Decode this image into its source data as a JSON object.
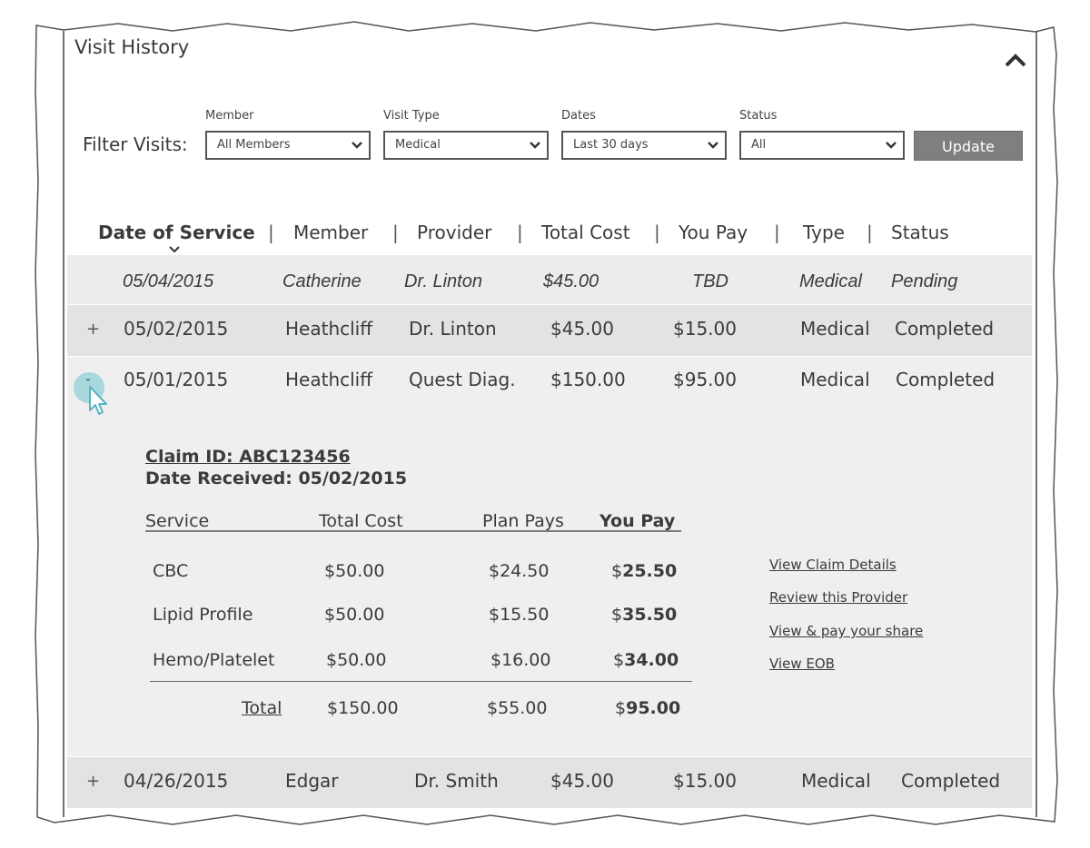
{
  "panel": {
    "title": "Visit History"
  },
  "filters": {
    "label": "Filter Visits:",
    "member": {
      "label": "Member",
      "value": "All Members"
    },
    "visit_type": {
      "label": "Visit Type",
      "value": "Medical"
    },
    "dates": {
      "label": "Dates",
      "value": "Last 30 days"
    },
    "status": {
      "label": "Status",
      "value": "All"
    },
    "update_label": "Update"
  },
  "table": {
    "columns": [
      "Date of Service",
      "Member",
      "Provider",
      "Total Cost",
      "You Pay",
      "Type",
      "Status"
    ],
    "separator": "|",
    "sorted_by": "Date of Service",
    "rows": [
      {
        "expand": "",
        "date": "05/04/2015",
        "member": "Catherine",
        "provider": "Dr. Linton",
        "total": "$45.00",
        "you_pay": "TBD",
        "type": "Medical",
        "status": "Pending"
      },
      {
        "expand": "+",
        "date": "05/02/2015",
        "member": "Heathcliff",
        "provider": "Dr. Linton",
        "total": "$45.00",
        "you_pay": "$15.00",
        "type": "Medical",
        "status": "Completed"
      },
      {
        "expand": "-",
        "date": "05/01/2015",
        "member": "Heathcliff",
        "provider": "Quest Diag.",
        "total": "$150.00",
        "you_pay": "$95.00",
        "type": "Medical",
        "status": "Completed"
      },
      {
        "expand": "+",
        "date": "04/26/2015",
        "member": "Edgar",
        "provider": "Dr. Smith",
        "total": "$45.00",
        "you_pay": "$15.00",
        "type": "Medical",
        "status": "Completed"
      }
    ]
  },
  "claim": {
    "claim_id": "Claim ID: ABC123456",
    "date_received": "Date Received: 05/02/2015",
    "headers": {
      "service": "Service",
      "total_cost": "Total Cost",
      "plan_pays": "Plan Pays",
      "you_pay": "You Pay"
    },
    "services": [
      {
        "name": "CBC",
        "total": "$50.00",
        "plan": "$24.50",
        "you_pay_symbol": "$",
        "you_pay_amount": "25.50"
      },
      {
        "name": "Lipid Profile",
        "total": "$50.00",
        "plan": "$15.50",
        "you_pay_symbol": "$",
        "you_pay_amount": "35.50"
      },
      {
        "name": "Hemo/Platelet",
        "total": "$50.00",
        "plan": "$16.00",
        "you_pay_symbol": "$",
        "you_pay_amount": "34.00"
      }
    ],
    "total": {
      "label": "Total",
      "total": "$150.00",
      "plan": "$55.00",
      "you_pay_symbol": "$",
      "you_pay_amount": "95.00"
    },
    "links": [
      "View Claim Details",
      "Review this Provider",
      "View & pay your share",
      "View EOB"
    ]
  },
  "icons": {
    "collapse": "chevron-up-icon",
    "select_arrow": "chevron-down-icon",
    "sort": "sort-down-icon",
    "cursor": "mouse-pointer-icon"
  },
  "colors": {
    "update_button": "#7f7f7f",
    "row_band": "#e3e3e3",
    "toggle_highlight": "#a6d8dd"
  }
}
